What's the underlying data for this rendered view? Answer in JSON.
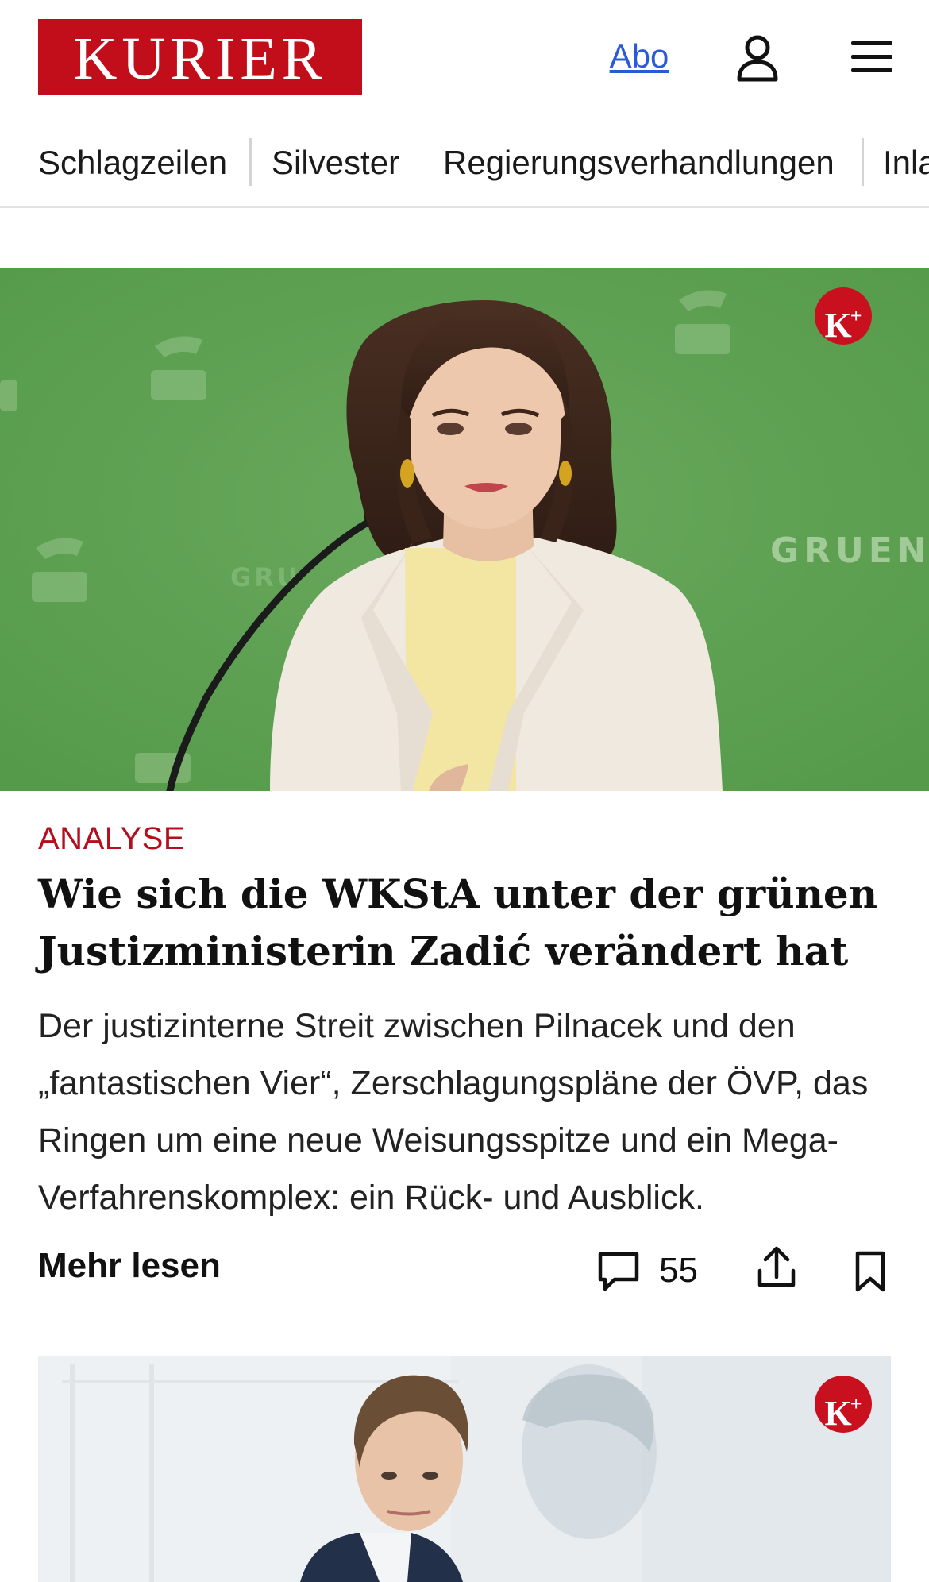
{
  "header": {
    "logo_text": "KURIER",
    "abo_label": "Abo",
    "user_icon": "user-icon",
    "menu_icon": "hamburger-menu-icon",
    "brand_color": "#c20e1a",
    "link_color": "#2a5bd7"
  },
  "nav": {
    "items": [
      {
        "label": "Schlagzeilen"
      },
      {
        "label": "Silvester"
      },
      {
        "label": "Regierungsverhandlungen"
      },
      {
        "label": "Inla"
      }
    ]
  },
  "articles": [
    {
      "badge": "K+",
      "kicker": "ANALYSE",
      "kicker_color": "#b40f1e",
      "headline": "Wie sich die WKStA unter der grünen Justizministerin Zadić verändert hat",
      "teaser": "Der justizinterne Streit zwischen Pilnacek und den „fantastischen Vier“, Zerschlagungspläne der ÖVP, das Ringen um eine neue Weisungsspitze und ein Mega-Verfahrenskomplex: ein Rück- und Ausblick.",
      "more_label": "Mehr lesen",
      "comment_count": "55",
      "comment_icon": "comment-icon",
      "share_icon": "share-icon",
      "bookmark_icon": "bookmark-icon",
      "background_text": "GRUENE.A"
    },
    {
      "badge": "K+"
    }
  ]
}
